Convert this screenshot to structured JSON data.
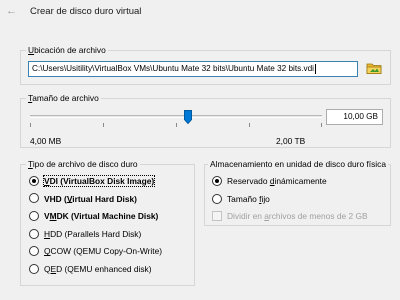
{
  "header": {
    "title": "Crear de disco duro virtual"
  },
  "location": {
    "legend_pre": "",
    "legend_u": "U",
    "legend_post": "bicación de archivo",
    "path": "C:\\Users\\Usitility\\VirtualBox VMs\\Ubuntu Mate 32 bits\\Ubuntu Mate 32 bits.vdi"
  },
  "size": {
    "legend_pre": "",
    "legend_u": "T",
    "legend_post": "amaño de archivo",
    "value": "10,00 GB",
    "min_label": "4,00 MB",
    "max_label": "2,00 TB",
    "slider_fraction": 0.54
  },
  "disk_type": {
    "legend_pre": "",
    "legend_u": "T",
    "legend_post": "ipo de archivo de disco duro",
    "options": [
      {
        "pre": "",
        "u": "V",
        "post": "DI (VirtualBox Disk Image)",
        "selected": true,
        "bold": true
      },
      {
        "pre": "VHD (",
        "u": "V",
        "post": "irtual Hard Disk)",
        "selected": false,
        "bold": true
      },
      {
        "pre": "V",
        "u": "M",
        "post": "DK (Virtual Machine Disk)",
        "selected": false,
        "bold": true
      },
      {
        "pre": "",
        "u": "H",
        "post": "DD (Parallels Hard Disk)",
        "selected": false,
        "bold": false
      },
      {
        "pre": "",
        "u": "Q",
        "post": "COW (QEMU Copy-On-Write)",
        "selected": false,
        "bold": false
      },
      {
        "pre": "Q",
        "u": "E",
        "post": "D (QEMU enhanced disk)",
        "selected": false,
        "bold": false
      }
    ]
  },
  "storage": {
    "legend": "Almacenamiento en unidad de disco duro física",
    "dynamic": {
      "pre": "Reservado ",
      "u": "d",
      "post": "inámicamente",
      "selected": true
    },
    "fixed": {
      "pre": "Tamaño ",
      "u": "f",
      "post": "ijo",
      "selected": false
    },
    "split": {
      "pre": "Dividir en ",
      "u": "a",
      "post": "rchivos de menos de 2 GB",
      "checked": false
    }
  }
}
